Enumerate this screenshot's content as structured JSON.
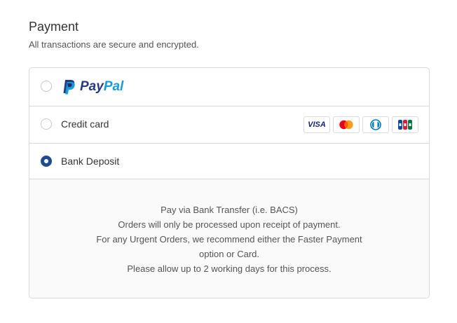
{
  "payment": {
    "title": "Payment",
    "subtitle": "All transactions are secure and encrypted."
  },
  "options": {
    "paypal": {
      "brand_part1": "Pay",
      "brand_part2": "Pal",
      "selected": false
    },
    "credit_card": {
      "label": "Credit card",
      "selected": false,
      "card_icons": [
        "visa-icon",
        "mastercard-icon",
        "diners-club-icon",
        "jcb-icon"
      ],
      "visa_text": "VISA"
    },
    "bank_deposit": {
      "label": "Bank Deposit",
      "selected": true
    }
  },
  "bank_info": {
    "lines": [
      "Pay via Bank Transfer (i.e. BACS)",
      "Orders will only be processed upon receipt of payment.",
      "For any Urgent Orders, we recommend either the Faster Payment",
      "option or Card.",
      "Please allow up to 2 working days for this process."
    ]
  },
  "colors": {
    "selected_radio": "#1f4c8f",
    "paypal_dark": "#253b80",
    "paypal_light": "#179bd7",
    "border": "#d9d9d9",
    "info_background": "#fafafa"
  }
}
